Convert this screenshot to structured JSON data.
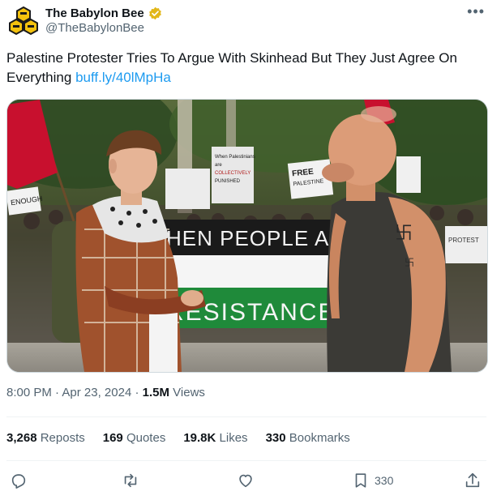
{
  "author": {
    "display_name": "The Babylon Bee",
    "handle": "@TheBabylonBee"
  },
  "tweet": {
    "text": "Palestine Protester Tries To Argue With Skinhead But They Just Agree On Everything",
    "link": "buff.ly/40lMpHa"
  },
  "image": {
    "sign_left_1": "FREE\nPALESTINE",
    "sign_left_2": "ENOUGH",
    "sign_center": "When Palestinians are\nCOLLECTIVELY\nPUNISHED",
    "sign_right": "FREE\nPALESTINE",
    "banner_top": "HEN PEOPLE ARE O",
    "banner_bottom": "RESISTANCE",
    "sign_far_right": "PROTEST",
    "colors": {
      "accent": "#1d9bf0",
      "banner_black": "#1a1a1a",
      "banner_green": "#1f8a3a",
      "flag_red": "#c8102e"
    }
  },
  "meta": {
    "time": "8:00 PM",
    "dot1": "·",
    "date": "Apr 23, 2024",
    "dot2": "·",
    "views_count": "1.5M",
    "views_label": "Views"
  },
  "stats": {
    "reposts_count": "3,268",
    "reposts_label": "Reposts",
    "quotes_count": "169",
    "quotes_label": "Quotes",
    "likes_count": "19.8K",
    "likes_label": "Likes",
    "bookmarks_count": "330",
    "bookmarks_label": "Bookmarks"
  },
  "actions": {
    "reply_icon": "reply-icon",
    "repost_icon": "repost-icon",
    "like_icon": "heart-icon",
    "bookmark_icon": "bookmark-icon",
    "bookmark_count": "330",
    "share_icon": "share-icon"
  }
}
